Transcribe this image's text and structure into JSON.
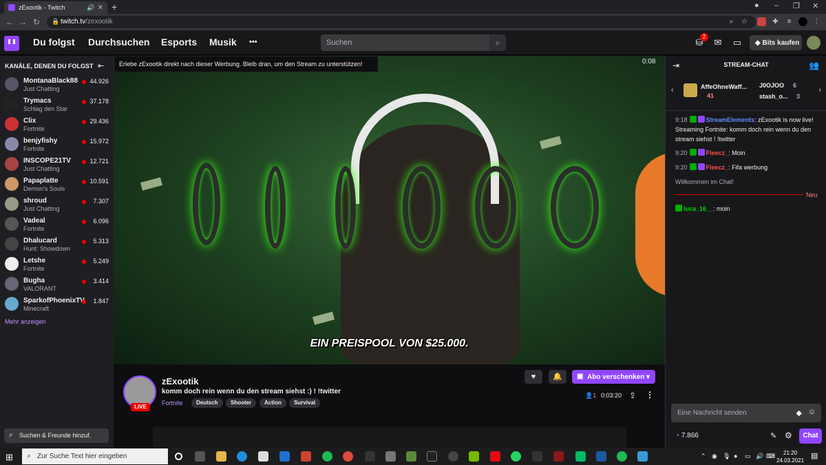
{
  "browser": {
    "tab_title": "zExootik - Twitch",
    "new_tab": "+",
    "url_host": "twitch.tv",
    "url_path": "/zexootik"
  },
  "topnav": {
    "following": "Du folgst",
    "browse": "Durchsuchen",
    "esports": "Esports",
    "music": "Musik",
    "more": "•••",
    "search_placeholder": "Suchen",
    "notif_count": "2",
    "bits_label": "Bits kaufen"
  },
  "sidebar": {
    "heading": "KANÄLE, DENEN DU FOLGST",
    "show_more": "Mehr anzeigen",
    "search_placeholder": "Suchen & Freunde hinzuf.",
    "channels": [
      {
        "name": "MontanaBlack88",
        "game": "Just Chatting",
        "viewers": "44.926",
        "color": "#556"
      },
      {
        "name": "Trymacs",
        "game": "Schlag den Star",
        "viewers": "37.178",
        "color": "#222"
      },
      {
        "name": "Clix",
        "game": "Fortnite",
        "viewers": "29.436",
        "color": "#c33"
      },
      {
        "name": "benjyfishy",
        "game": "Fortnite",
        "viewers": "15.972",
        "color": "#88a"
      },
      {
        "name": "INSCOPE21TV",
        "game": "Just Chatting",
        "viewers": "12.721",
        "color": "#a44"
      },
      {
        "name": "Papaplatte",
        "game": "Demon's Souls",
        "viewers": "10.591",
        "color": "#c96"
      },
      {
        "name": "shroud",
        "game": "Just Chatting",
        "viewers": "7.307",
        "color": "#998"
      },
      {
        "name": "Vadeal",
        "game": "Fortnite",
        "viewers": "6.096",
        "color": "#555"
      },
      {
        "name": "Dhalucard",
        "game": "Hunt: Showdown",
        "viewers": "5.313",
        "color": "#444"
      },
      {
        "name": "Letshe",
        "game": "Fortnite",
        "viewers": "5.249",
        "color": "#eee"
      },
      {
        "name": "Bugha",
        "game": "VALORANT",
        "viewers": "3.414",
        "color": "#667"
      },
      {
        "name": "SparkofPhoenixTV",
        "game": "Minecraft",
        "viewers": "1.847",
        "color": "#6ac"
      }
    ]
  },
  "video": {
    "ad_banner": "Erlebe zExootik direkt nach dieser Werbung. Bleib dran, um den Stream zu unterstützen!",
    "ad_time": "0:08",
    "caption": "EIN PREISPOOL VON $25.000."
  },
  "channel": {
    "name": "zExootik",
    "title": "komm doch rein wenn du den stream siehst :) ! !twitter",
    "game": "Fortnite",
    "live": "LIVE",
    "tags": [
      "Deutsch",
      "Shooter",
      "Action",
      "Survival"
    ],
    "gift_label": "Abo verschenken",
    "viewers": "1",
    "uptime": "0:03:20"
  },
  "chat": {
    "header": "STREAM-CHAT",
    "gifters": [
      {
        "name": "AffeOhneWaff...",
        "count": "41"
      },
      {
        "name": "J0OJOO",
        "count": "6"
      },
      {
        "name": "stash_o...",
        "count": "3"
      }
    ],
    "messages": [
      {
        "time": "9:18",
        "user": "StreamElements",
        "color": "#5c8dff",
        "text": ": zExootik is now live! Streaming Fortnite: komm doch rein wenn du den stream siehst  ! !twitter"
      },
      {
        "time": "9:20",
        "user": "Fleecz_",
        "color": "#ff4f4f",
        "text": ": Moin"
      },
      {
        "time": "9:20",
        "user": "Fleecz_",
        "color": "#ff4f4f",
        "text": ": Fifa werbung"
      }
    ],
    "welcome": "Willkommen im Chat!",
    "new_label": "Neu",
    "new_message": {
      "user": "luca_16__",
      "color": "#00d400",
      "text": ": moin"
    },
    "input_placeholder": "Eine Nachricht senden",
    "points": "7.866",
    "send_label": "Chat"
  },
  "taskbar": {
    "search_placeholder": "Zur Suche Text hier eingeben",
    "time": "21:20",
    "date": "24.03.2021"
  }
}
